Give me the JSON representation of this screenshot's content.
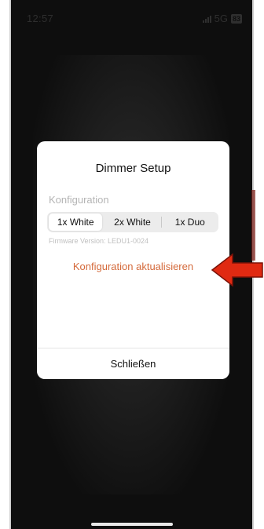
{
  "status_bar": {
    "time": "12:57",
    "network": "5G",
    "battery": "83"
  },
  "dialog": {
    "title": "Dimmer Setup",
    "config_label": "Konfiguration",
    "segments": [
      "1x White",
      "2x White",
      "1x Duo"
    ],
    "selected_segment": "1x White",
    "firmware": "Firmware Version: LEDU1-0024",
    "update_link": "Konfiguration aktualisieren",
    "close_label": "Schließen"
  },
  "colors": {
    "accent": "#d4693a",
    "arrow": "#e02a12"
  },
  "icons": [
    "signal-icon",
    "battery-icon",
    "red-arrow-icon"
  ]
}
